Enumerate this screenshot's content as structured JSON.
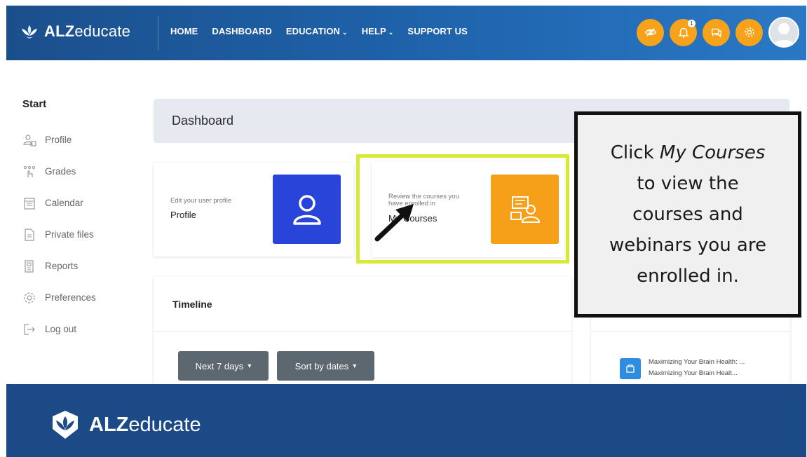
{
  "brand": {
    "bold": "ALZ",
    "rest": "educate"
  },
  "nav": {
    "home": "HOME",
    "dashboard": "DASHBOARD",
    "education": "EDUCATION",
    "help": "HELP",
    "support": "SUPPORT US"
  },
  "top_icons": {
    "notification_count": "1",
    "accent_color": "#f7a21b"
  },
  "sidebar": {
    "title": "Start",
    "items": [
      {
        "label": "Profile",
        "icon": "profile-icon"
      },
      {
        "label": "Grades",
        "icon": "grades-icon"
      },
      {
        "label": "Calendar",
        "icon": "calendar-icon"
      },
      {
        "label": "Private files",
        "icon": "files-icon"
      },
      {
        "label": "Reports",
        "icon": "reports-icon"
      },
      {
        "label": "Preferences",
        "icon": "gear-icon"
      },
      {
        "label": "Log out",
        "icon": "logout-icon"
      }
    ]
  },
  "dashboard": {
    "title": "Dashboard"
  },
  "cards": {
    "profile": {
      "sub": "Edit your user profile",
      "title": "Profile"
    },
    "courses": {
      "sub_line1": "Review the courses you",
      "sub_line2": "have enrolled in",
      "title": "My Courses"
    }
  },
  "timeline": {
    "title": "Timeline",
    "filter_days": "Next 7 days",
    "sort": "Sort by dates"
  },
  "right_panel": {
    "course_line1": "Maximizing Your Brain Health: ...",
    "course_line2": "Maximizing Your Brain Healt..."
  },
  "callout": {
    "line1_prefix": "Click ",
    "line1_em": "My Courses",
    "line2": "to view the",
    "line3": "courses and",
    "line4": "webinars you are",
    "line5": "enrolled in."
  },
  "colors": {
    "nav_blue": "#1f64ad",
    "footer_blue": "#1b4a86",
    "profile_tile": "#2844d9",
    "courses_tile": "#f6a01a",
    "highlight": "#d6ea37"
  }
}
